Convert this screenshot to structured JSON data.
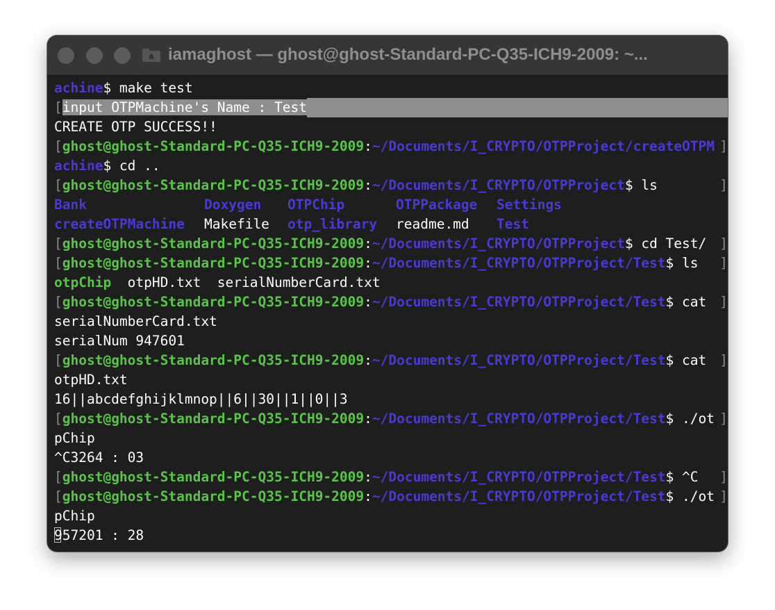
{
  "window": {
    "title": "iamaghost — ghost@ghost-Standard-PC-Q35-ICH9-2009: ~..."
  },
  "prompt": {
    "user_host": "ghost@ghost-Standard-PC-Q35-ICH9-2009",
    "colon": ":",
    "dollar": "$"
  },
  "lines": {
    "l1_blue": "achine",
    "l1_cmd": "$ make test",
    "l2_text": "input OTPMachine's Name : Test",
    "l3_text": "CREATE OTP SUCCESS!!",
    "l4_path": "~/Documents/I_CRYPTO/OTPProject/createOTPM",
    "l5_blue": "achine",
    "l5_cmd": "$ cd ..",
    "l6_path": "~/Documents/I_CRYPTO/OTPProject",
    "l6_cmd": "$ ls",
    "ls1": [
      "Bank",
      "Doxygen",
      "OTPChip",
      "OTPPackage",
      "Settings"
    ],
    "ls2": [
      "createOTPMachine",
      "Makefile",
      "otp_library",
      "readme.md",
      "Test"
    ],
    "l9_cmd": "$ cd Test/",
    "l10_path": "~/Documents/I_CRYPTO/OTPProject/Test",
    "l10_cmd": "$ ls",
    "l11_dir": "otpChip",
    "l11_files": "  otpHD.txt  serialNumberCard.txt",
    "l12_cmd": "$ cat",
    "l13_text": "serialNumberCard.txt",
    "l14_text": "serialNum 947601",
    "l15_cmd": "$ cat",
    "l16_text": "otpHD.txt",
    "l17_text": "16||abcdefghijklmnop||6||30||1||0||3",
    "l18_cmd": "$ ./ot",
    "l19_text": "pChip",
    "l20_text": "^C3264 : 03",
    "l21_cmd": "$ ^C",
    "l22_cmd": "$ ./ot",
    "l23_text": "pChip",
    "l24_text": "957201 : 28"
  },
  "brackets": {
    "open": "[",
    "close": "]"
  },
  "colors": {
    "background": "#1e1e1e",
    "titlebar": "#363636",
    "prompt_user": "#5ac44a",
    "prompt_path": "#4a3ad2",
    "highlight": "#8e8e8e"
  },
  "icons": {
    "title_icon": "folder-icon"
  }
}
